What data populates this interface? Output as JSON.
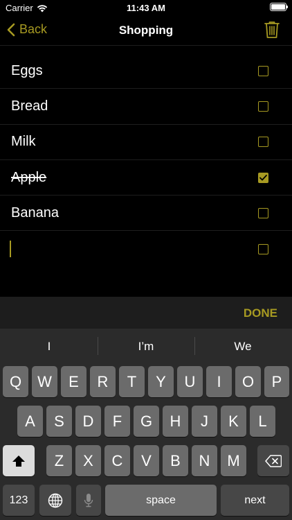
{
  "status": {
    "carrier": "Carrier",
    "time": "11:43 AM"
  },
  "nav": {
    "back_label": "Back",
    "title": "Shopping"
  },
  "list": {
    "items": [
      {
        "label": "Eggs",
        "checked": false
      },
      {
        "label": "Bread",
        "checked": false
      },
      {
        "label": "Milk",
        "checked": false
      },
      {
        "label": "Apple",
        "checked": true
      },
      {
        "label": "Banana",
        "checked": false
      },
      {
        "label": "",
        "checked": false
      }
    ]
  },
  "accessory": {
    "done_label": "DONE"
  },
  "keyboard": {
    "suggestions": [
      "I",
      "I’m",
      "We"
    ],
    "row1": [
      "Q",
      "W",
      "E",
      "R",
      "T",
      "Y",
      "U",
      "I",
      "O",
      "P"
    ],
    "row2": [
      "A",
      "S",
      "D",
      "F",
      "G",
      "H",
      "J",
      "K",
      "L"
    ],
    "row3": [
      "Z",
      "X",
      "C",
      "V",
      "B",
      "N",
      "M"
    ],
    "numbers_label": "123",
    "space_label": "space",
    "next_label": "next"
  },
  "colors": {
    "accent": "#a79a22",
    "background": "#000000",
    "keyboard": "#2b2b2b",
    "key": "#6b6b6b"
  },
  "icons": {
    "back": "chevron-left-icon",
    "trash": "trash-icon",
    "wifi": "wifi-icon",
    "battery": "battery-icon",
    "shift": "shift-icon",
    "delete": "backspace-icon",
    "globe": "globe-icon",
    "mic": "microphone-icon"
  }
}
